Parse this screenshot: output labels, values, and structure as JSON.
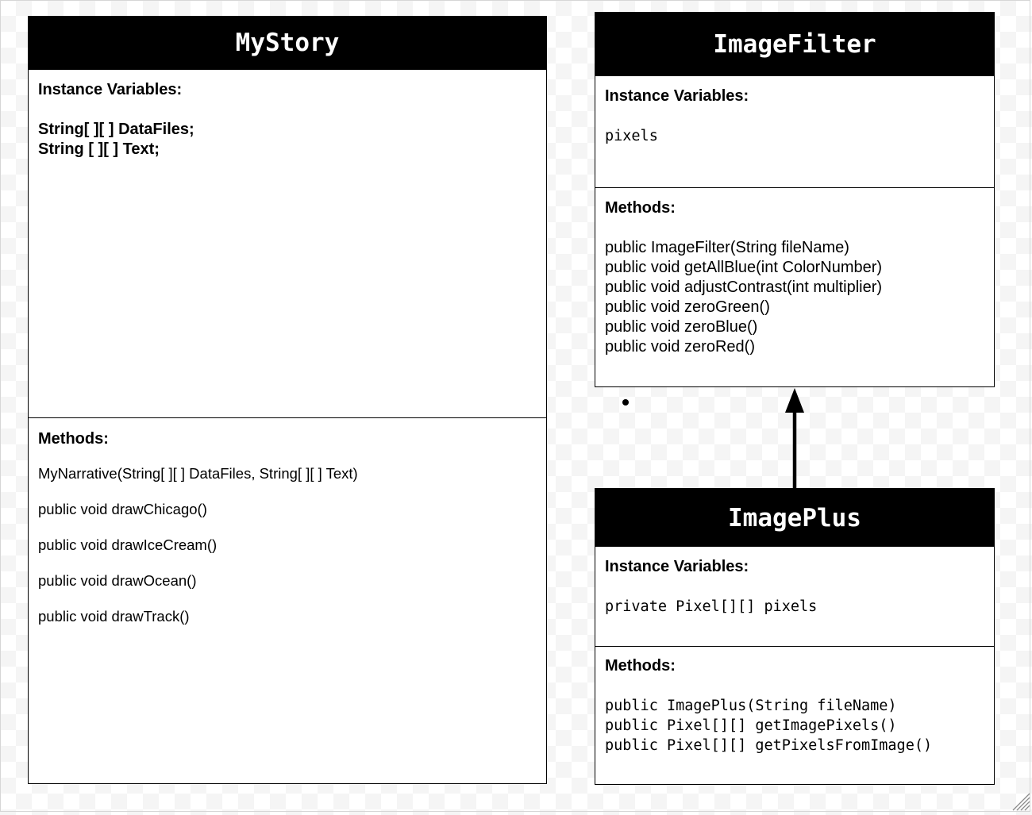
{
  "classes": {
    "mystory": {
      "name": "MyStory",
      "instance_title": "Instance Variables:",
      "variables": [
        "String[ ][ ] DataFiles;",
        "String [ ][ ] Text;"
      ],
      "methods_title": "Methods:",
      "methods": [
        "MyNarrative(String[ ][ ] DataFiles, String[ ][ ] Text)",
        "public void drawChicago()",
        "public void drawIceCream()",
        "public void drawOcean()",
        "public void drawTrack()"
      ]
    },
    "imagefilter": {
      "name": "ImageFilter",
      "instance_title": "Instance Variables:",
      "variables": [
        "pixels"
      ],
      "methods_title": "Methods:",
      "methods": [
        "public ImageFilter(String fileName)",
        "public void getAllBlue(int ColorNumber)",
        "public void adjustContrast(int multiplier)",
        "public void zeroGreen()",
        "public void zeroBlue()",
        "public void zeroRed()"
      ]
    },
    "imageplus": {
      "name": "ImagePlus",
      "instance_title": "Instance Variables:",
      "variables": [
        "private Pixel[][] pixels"
      ],
      "methods_title": "Methods:",
      "methods": [
        "public ImagePlus(String fileName)",
        "public Pixel[][] getImagePixels()",
        "public Pixel[][] getPixelsFromImage()"
      ]
    }
  },
  "relationships": [
    {
      "type": "inheritance",
      "from": "ImagePlus",
      "to": "ImageFilter"
    }
  ],
  "colors": {
    "header_bg": "#000000",
    "header_text": "#ffffff",
    "border": "#000000"
  }
}
